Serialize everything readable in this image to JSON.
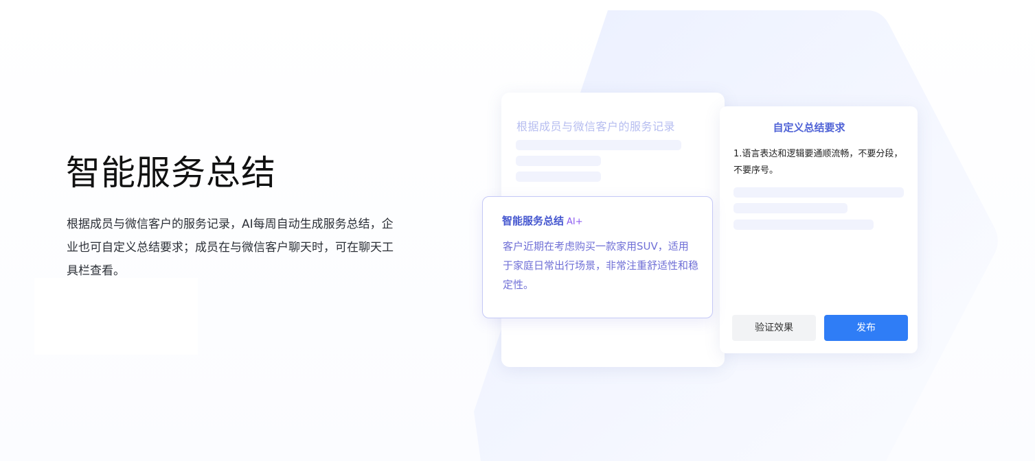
{
  "hero": {
    "title": "智能服务总结",
    "description": "根据成员与微信客户的服务记录，AI每周自动生成服务总结，企业也可自定义总结要求；成员在与微信客户聊天时，可在聊天工具栏查看。"
  },
  "record_card": {
    "title": "根据成员与微信客户的服务记录"
  },
  "requirements_card": {
    "title": "自定义总结要求",
    "requirement_text": "1.语言表达和逻辑要通顺流畅，不要分段，不要序号。",
    "verify_button": "验证效果",
    "publish_button": "发布"
  },
  "summary_card": {
    "title": "智能服务总结",
    "ai_badge": "AI+",
    "content": "客户近期在考虑购买一款家用SUV，适用于家庭日常出行场景，非常注重舒适性和稳定性。"
  },
  "colors": {
    "accent_blue": "#2f7df6",
    "summary_title": "#4456cf",
    "summary_text": "#6f6fd6",
    "ai_badge": "#8c5cf0",
    "placeholder_bar": "#f1f3fd"
  }
}
